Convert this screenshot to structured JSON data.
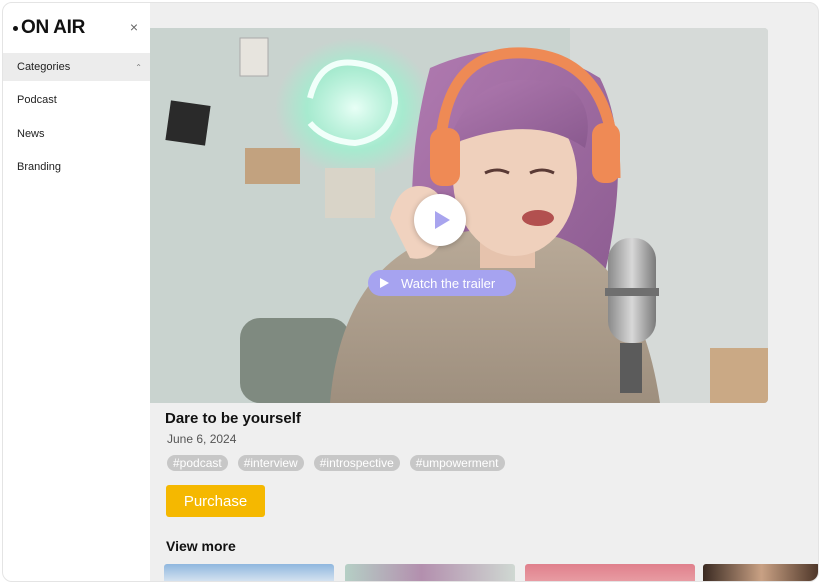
{
  "brand": {
    "logo_text": "ON AIR"
  },
  "sidebar": {
    "close_glyph": "×",
    "section_label": "Categories",
    "items": [
      {
        "label": "Podcast"
      },
      {
        "label": "News"
      },
      {
        "label": "Branding"
      }
    ]
  },
  "hero": {
    "trailer_label": "Watch the trailer"
  },
  "episode": {
    "title": "Dare to be yourself",
    "date": "June 6, 2024",
    "tags": [
      "#podcast",
      "#interview",
      "#introspective",
      "#umpowerment"
    ],
    "purchase_label": "Purchase"
  },
  "view_more": {
    "heading": "View more"
  },
  "colors": {
    "accent": "#a6a3f0",
    "purchase": "#f5b800",
    "tag_bg": "#c7c7c7",
    "sidebar_active": "#ececec"
  }
}
